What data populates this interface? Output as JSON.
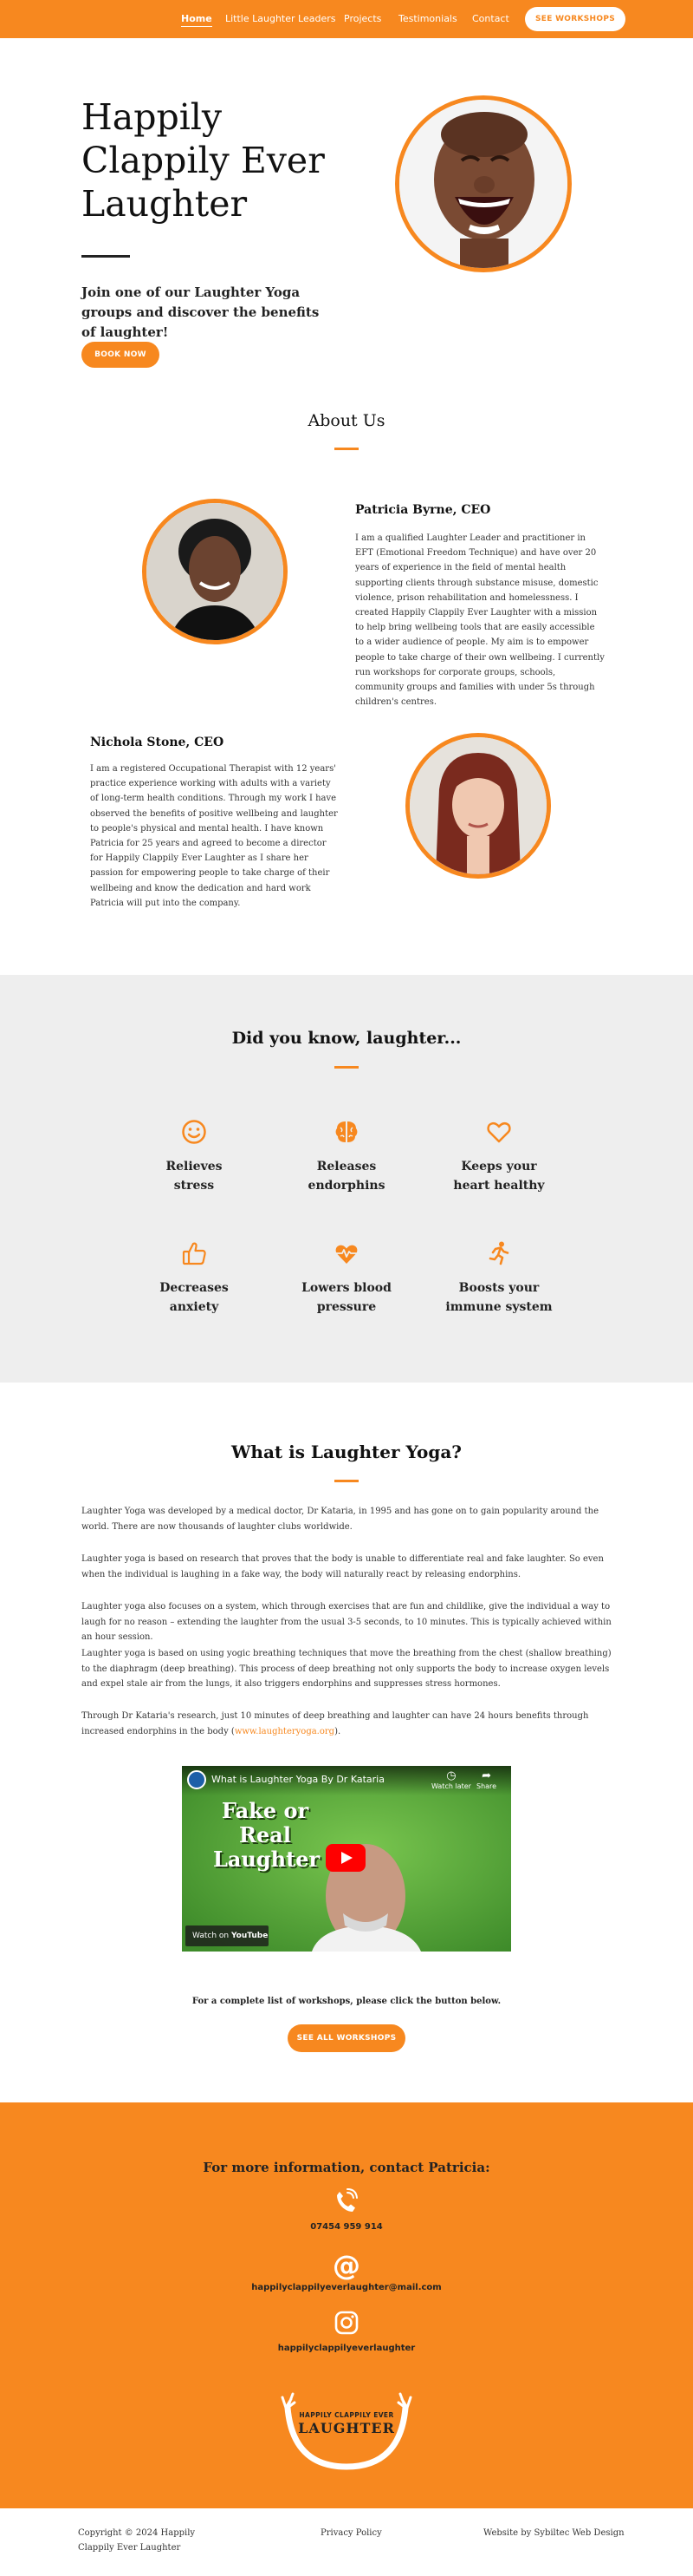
{
  "nav": {
    "items": [
      {
        "label": "Home"
      },
      {
        "label": "Little Laughter Leaders"
      },
      {
        "label": "Projects"
      },
      {
        "label": "Testimonials"
      },
      {
        "label": "Contact"
      }
    ],
    "cta": "SEE WORKSHOPS"
  },
  "hero": {
    "title": "Happily Clappily Ever Laughter",
    "subtitle": "Join one of our Laughter Yoga groups and discover the benefits of laughter!",
    "button": "BOOK NOW"
  },
  "about": {
    "title": "About Us",
    "people": [
      {
        "name": "Patricia Byrne, CEO",
        "bio": "I am a qualified Laughter Leader and practitioner in EFT (Emotional Freedom Technique) and have over 20 years of experience in the field of mental health supporting clients through substance misuse, domestic violence, prison rehabilitation and homelessness. I created Happily Clappily Ever Laughter with a mission to help bring wellbeing tools that are easily accessible to a wider audience of people. My aim is to empower people to take charge of their own wellbeing. I currently run workshops for corporate groups, schools, community groups and families with under 5s through children's centres."
      },
      {
        "name": "Nichola Stone, CEO",
        "bio": "I am a registered Occupational Therapist with 12 years' practice experience working with adults with a variety of long-term health conditions. Through my work I have observed the benefits of positive wellbeing and laughter to people's physical and mental health. I have known Patricia for 25 years and agreed to become a director for Happily Clappily Ever Laughter as I share her passion for empowering people to take charge of their wellbeing and know the dedication and hard work Patricia will put into the company."
      }
    ]
  },
  "facts": {
    "title": "Did you know, laughter...",
    "items": [
      {
        "icon": "smile-icon",
        "line1": "Relieves",
        "line2": "stress"
      },
      {
        "icon": "brain-icon",
        "line1": "Releases",
        "line2": "endorphins"
      },
      {
        "icon": "heart-icon",
        "line1": "Keeps your",
        "line2": "heart healthy"
      },
      {
        "icon": "thumbs-up-icon",
        "line1": "Decreases",
        "line2": "anxiety"
      },
      {
        "icon": "heartbeat-icon",
        "line1": "Lowers blood",
        "line2": "pressure"
      },
      {
        "icon": "running-icon",
        "line1": "Boosts your",
        "line2": "immune system"
      }
    ]
  },
  "yoga": {
    "title": "What is Laughter Yoga?",
    "paragraphs": [
      "Laughter Yoga was developed by a medical doctor, Dr Kataria, in 1995 and has gone on to gain popularity around the world. There are now thousands of laughter clubs worldwide.",
      "Laughter yoga is based on research that proves that the body is unable to differentiate real and fake laughter. So even when the individual is laughing in a fake way, the body will naturally react by releasing endorphins.",
      "Laughter yoga also focuses on a system, which through exercises that are fun and childlike, give the individual a way to laugh for no reason – extending the laughter from the usual 3-5 seconds, to 10 minutes. This is typically achieved within an hour session.",
      "Laughter yoga is based on using yogic breathing techniques that move the breathing from the chest (shallow breathing) to the diaphragm (deep breathing). This process of deep breathing not only supports the body to increase oxygen levels and expel stale air from the lungs, it also triggers endorphins and suppresses stress hormones."
    ],
    "last_paragraph_before": "Through Dr Kataria's research, just 10 minutes of deep breathing and laughter can have 24 hours benefits through increased endorphins in the body (",
    "last_paragraph_link": "www.laughteryoga.org",
    "last_paragraph_after": ").",
    "video": {
      "title": "What is Laughter Yoga By Dr Kataria",
      "watch_later": "Watch later",
      "share": "Share",
      "overlay_text": "Fake or Real Laughter",
      "watch_on": "Watch on",
      "platform": "YouTube"
    },
    "list_note": "For a complete list of workshops, please click the button below.",
    "button": "SEE ALL WORKSHOPS"
  },
  "contact": {
    "title": "For more information, contact Patricia:",
    "phone": "07454 959 914",
    "email": "happilyclappilyeverlaughter@mail.com",
    "instagram": "happilyclappilyeverlaughter",
    "logo_top": "HAPPILY CLAPPILY EVER",
    "logo_main": "LAUGHTER"
  },
  "footer": {
    "copyright": "Copyright © 2024 Happily Clappily Ever Laughter",
    "privacy": "Privacy Policy",
    "credit": "Website by Sybiltec Web Design"
  },
  "colors": {
    "accent": "#f7881f",
    "grey_band": "#eeeeee"
  }
}
